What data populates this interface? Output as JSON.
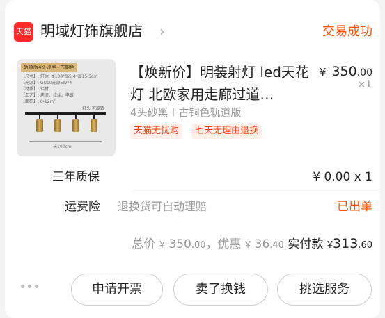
{
  "store": {
    "logo_text": "天猫",
    "name": "明域灯饰旗舰店",
    "chevron": "›",
    "status": "交易成功"
  },
  "product": {
    "thumb_tag": "轨道版4头砂黑+古铜色",
    "thumb_specs": [
      "【尺寸】: 灯体: Φ100*高5.4*高15.5cm",
      "【光源】: GU10光源5W*4",
      "【材质】: 铝材",
      "【工艺】: 烤漆、拉丝、电镀",
      "【面积】: 8-12m²"
    ],
    "thumb_note": "灯头 可旋转",
    "thumb_dim": "长100cm",
    "title": "【焕新价】明装射灯 led天花灯 北欧家用走廊过道…",
    "sku": "4头砂黑＋古铜色轨道版",
    "badges": [
      "天猫无忧购",
      "七天无理由退换"
    ],
    "price_currency": "¥",
    "price_int": "350",
    "price_dec": ".00",
    "qty": "×1"
  },
  "warranty": {
    "label": "三年质保",
    "value": "¥ 0.00 x 1"
  },
  "shipping_insurance": {
    "label": "运费险",
    "desc": "退换货可自动理赔",
    "status": "已出单"
  },
  "totals": {
    "total_label": "总价",
    "total_cur": "¥",
    "total_int": "350",
    "total_dec": ".00",
    "sep": "，",
    "discount_label": "优惠",
    "discount_cur": "¥",
    "discount_int": "36",
    "discount_dec": ".40",
    "paid_label": "实付款",
    "paid_cur": "¥",
    "paid_int": "313",
    "paid_dec": ".60"
  },
  "actions": {
    "more_icon": "more-dots-icon",
    "invoice": "申请开票",
    "resell": "卖了换钱",
    "services": "挑选服务"
  },
  "colors": {
    "accent": "#ff5000",
    "brand_red": "#ff2a2a",
    "badge_bg": "#fff0ea"
  }
}
